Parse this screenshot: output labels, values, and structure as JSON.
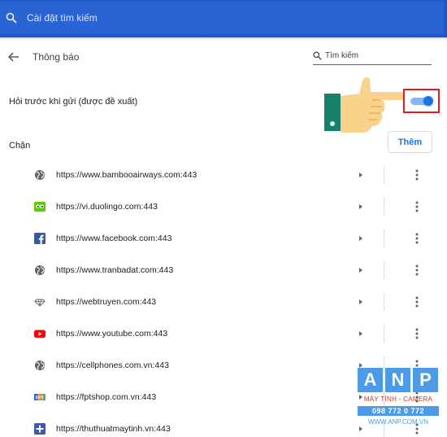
{
  "search": {
    "placeholder": "Cài đặt tìm kiếm"
  },
  "header": {
    "title": "Thông báo",
    "search_placeholder": "Tìm kiếm"
  },
  "ask_setting": {
    "label": "Hỏi trước khi gửi (được đề xuất)",
    "enabled": true
  },
  "block_section": {
    "label": "Chặn",
    "add_label": "Thêm"
  },
  "blocked_sites": [
    {
      "url": "https://www.bambooairways.com:443",
      "icon": "globe-icon"
    },
    {
      "url": "https://vi.duolingo.com:443",
      "icon": "duolingo-icon"
    },
    {
      "url": "https://www.facebook.com:443",
      "icon": "facebook-icon"
    },
    {
      "url": "https://www.tranbadat.com:443",
      "icon": "globe-icon"
    },
    {
      "url": "https://webtruyen.com:443",
      "icon": "diamond-icon"
    },
    {
      "url": "https://www.youtube.com:443",
      "icon": "youtube-icon"
    },
    {
      "url": "https://cellphones.com.vn:443",
      "icon": "globe-icon"
    },
    {
      "url": "https://fptshop.com.vn:443",
      "icon": "fpt-icon"
    },
    {
      "url": "https://thuthuatmaytinh.vn:443",
      "icon": "plus-square-icon"
    }
  ],
  "watermark": {
    "letters": [
      "A",
      "N",
      "P"
    ],
    "line1": "MÁY TÍNH - CAMERA",
    "line2": "098 772 0 772",
    "line3": "WWW.ANP.COM.VN"
  },
  "colors": {
    "top_bar": "#1f57c9",
    "accent": "#1a73e8",
    "highlight_box": "#e11b22",
    "watermark_blue": "#4d9be6"
  }
}
